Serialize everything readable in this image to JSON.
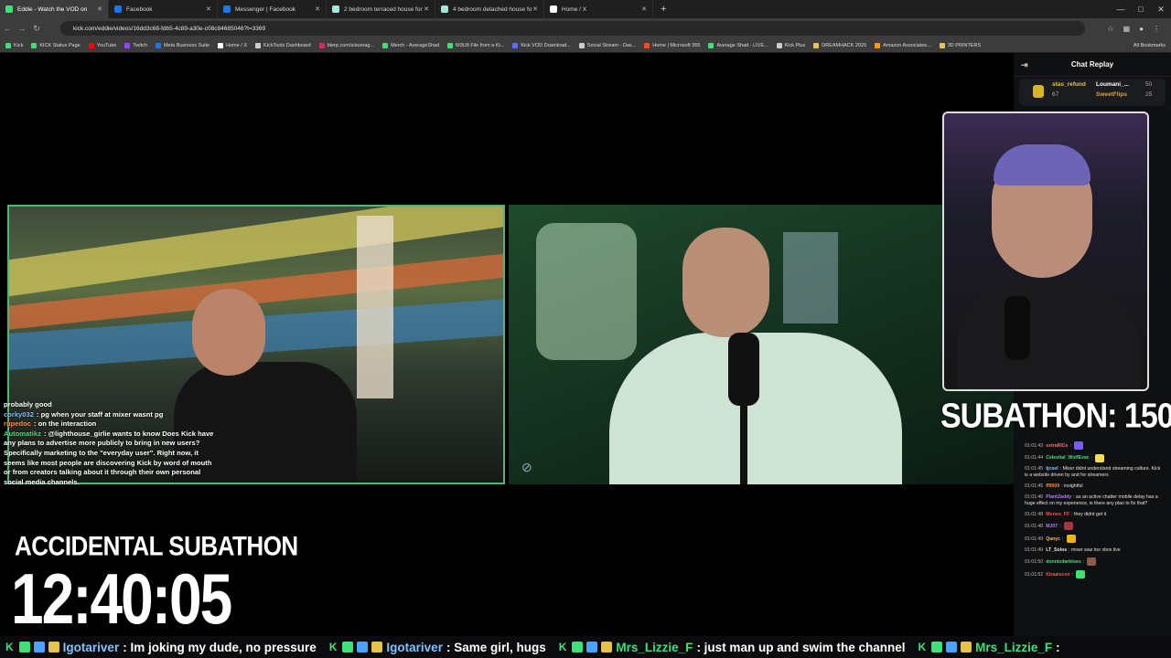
{
  "browser": {
    "tabs": [
      {
        "title": "Eddie - Watch the VOD on",
        "color": "#3ee07a",
        "active": true
      },
      {
        "title": "Facebook",
        "color": "#1877f2",
        "active": false
      },
      {
        "title": "Messenger | Facebook",
        "color": "#1877f2",
        "active": false
      },
      {
        "title": "2 bedroom terraced house for",
        "color": "#a5e6d8",
        "active": false
      },
      {
        "title": "4 bedroom detached house fo",
        "color": "#a5e6d8",
        "active": false
      },
      {
        "title": "Home / X",
        "color": "#ffffff",
        "active": false
      }
    ],
    "new_tab": "+",
    "url": "kick.com/eddie/videos/16dd3c68-fdb5-4c89-a30e-c08c84685046?t=3369",
    "bookmarks": [
      {
        "label": "Kick",
        "color": "#3ee07a"
      },
      {
        "label": "KICK Status Page",
        "color": "#3ee07a"
      },
      {
        "label": "YouTube",
        "color": "#ff0000"
      },
      {
        "label": "Twitch",
        "color": "#9146ff"
      },
      {
        "label": "Meta Business Suite",
        "color": "#1877f2"
      },
      {
        "label": "Home / X",
        "color": "#ffffff"
      },
      {
        "label": "KickTools Dashboard",
        "color": "#cccccc"
      },
      {
        "label": "blerp.com/s/averag...",
        "color": "#e0245e"
      },
      {
        "label": "Merch - AverageShad",
        "color": "#3ee07a"
      },
      {
        "label": "M3U8 File from a Ki...",
        "color": "#3ee07a"
      },
      {
        "label": "Kick VOD Download...",
        "color": "#5b6cff"
      },
      {
        "label": "Social Stream - Das...",
        "color": "#cccccc"
      },
      {
        "label": "Home | Microsoft 365",
        "color": "#f25022"
      },
      {
        "label": "Average Shad - LIVE...",
        "color": "#3ee07a"
      },
      {
        "label": "Kick Plus",
        "color": "#cccccc"
      },
      {
        "label": "DREAMHACK 2025",
        "color": "#e8c35a"
      },
      {
        "label": "Amazon Associates...",
        "color": "#ff9900"
      },
      {
        "label": "3D PRINTERS",
        "color": "#e8c35a"
      }
    ],
    "all_bookmarks": "All Bookmarks"
  },
  "stream": {
    "overlay_chat": [
      {
        "user": "",
        "text": "probably good",
        "color": "#ffffff"
      },
      {
        "user": "corky032",
        "text": ": pg when your staff at mixer wasnt pg",
        "color": "#7ec3ff"
      },
      {
        "user": "rupedoc",
        "text": ": on the interaction",
        "color": "#ff8f3a"
      },
      {
        "user": "Automatikz",
        "text": ": @lighthouse_girlie wants to know Does Kick have any plans to advertise more publicly to bring in new users? Specifically marketing to the \"everyday user\". Right now, it seems like most people are discovering Kick by word of mouth or from creators talking about it through their own personal social media channels.",
        "color": "#3ee07a"
      }
    ],
    "subathon_label": "ACCIDENTAL SUBATHON",
    "timer": "12:40:05",
    "subathon_count": "SUBATHON: 150"
  },
  "chat": {
    "title": "Chat Replay",
    "pinned": [
      {
        "name": "stas_refund",
        "count": "67"
      },
      {
        "name": "Loumani_...",
        "count": "50"
      },
      {
        "name": "SweetFlips",
        "count": "25"
      }
    ],
    "messages": [
      {
        "time": "01:01:43",
        "user": "extraRICe",
        "text": ":",
        "color": "#ff6b6b",
        "emote": "#7a5cff"
      },
      {
        "time": "01:01:44",
        "user": "Celestial_WolfEvac",
        "text": ":",
        "color": "#3ee07a",
        "emote": "#f4e04d"
      },
      {
        "time": "01:01:45",
        "user": "tjcoel",
        "text": ": Mixer didnt understand streaming culture. Kick is a website driven by and for streamers",
        "color": "#7ec3ff",
        "emote": ""
      },
      {
        "time": "01:01:45",
        "user": "ff9000",
        "text": ": insightful",
        "color": "#ff8f3a",
        "emote": ""
      },
      {
        "time": "01:01:46",
        "user": "PlantZaddy",
        "text": ": as an active chatter mobile delay has a huge effect on my experience, is there any plan to fix that?",
        "color": "#b57cff",
        "emote": ""
      },
      {
        "time": "01:01:48",
        "user": "Moneo_FF",
        "text": ": they didnt get it",
        "color": "#ff4d4d",
        "emote": ""
      },
      {
        "time": "01:01:48",
        "user": "MJ07",
        "text": ":",
        "color": "#b57cff",
        "emote": "#aa3344"
      },
      {
        "time": "01:01:49",
        "user": "Qanyc",
        "text": ":",
        "color": "#e3c34a",
        "emote": "#f4b400"
      },
      {
        "time": "01:01:49",
        "user": "LT_Solos",
        "text": ": mixer was too xbox live",
        "color": "#e6e6e6",
        "emote": ""
      },
      {
        "time": "01:01:50",
        "user": "donniedarktoes",
        "text": ":",
        "color": "#3ee07a",
        "emote": "#8a5a4a"
      },
      {
        "time": "01:01:52",
        "user": "Kiraaiscoo",
        "text": ":",
        "color": "#ff4d4d",
        "emote": "#3ee07a"
      }
    ]
  },
  "ticker": [
    {
      "user": "Igotariver",
      "text": ": Im joking my dude, no pressure",
      "color": "#7ec3ff"
    },
    {
      "user": "Igotariver",
      "text": ": Same girl, hugs",
      "color": "#7ec3ff"
    },
    {
      "user": "Mrs_Lizzie_F",
      "text": ": just man up and swim the channel",
      "color": "#3ee07a"
    },
    {
      "user": "Mrs_Lizzie_F",
      "text": ":",
      "color": "#3ee07a"
    }
  ]
}
